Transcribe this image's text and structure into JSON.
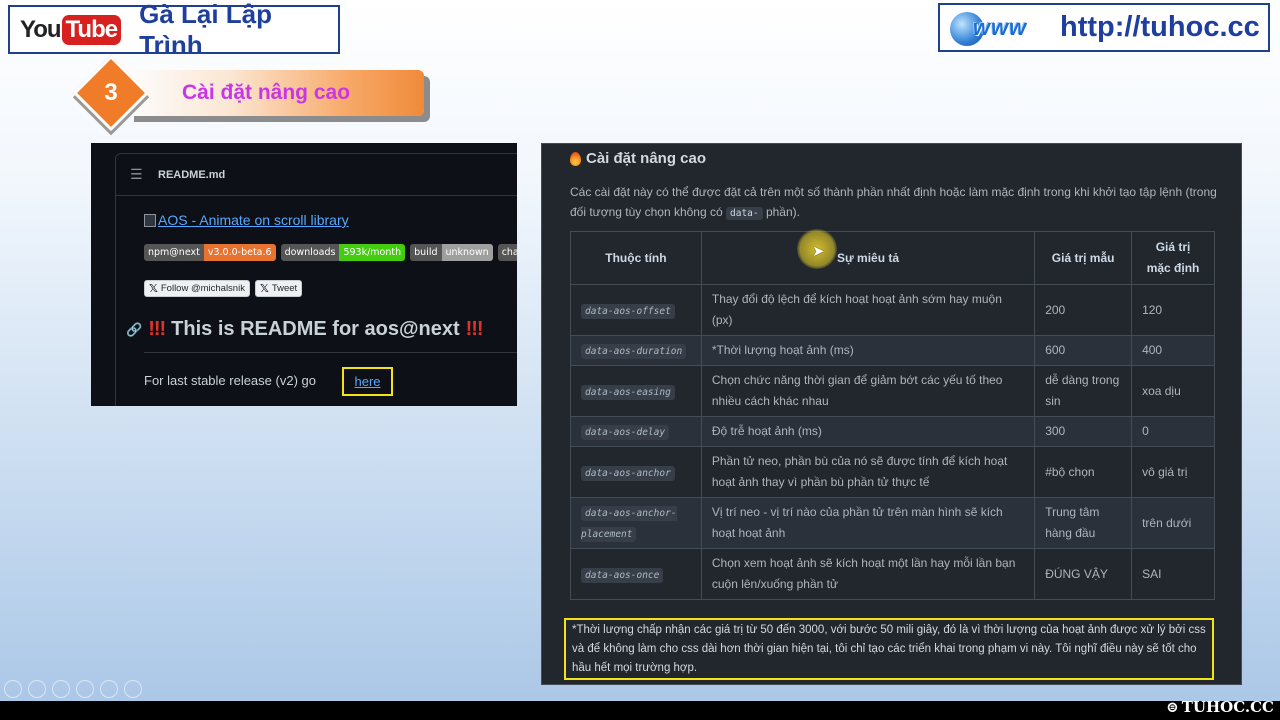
{
  "header": {
    "yt_you": "You",
    "yt_tube": "Tube",
    "channel_name": "Gà Lại Lập Trình",
    "www_text": "www",
    "site_url": "http://tuhoc.cc"
  },
  "step": {
    "number": "3",
    "title": "Cài đặt nâng cao"
  },
  "readme": {
    "file_name": "README.md",
    "aos_link": "AOS - Animate on scroll library",
    "badges": [
      {
        "key": "npm@next",
        "value": "v3.0.0-beta.6",
        "color": "#e8722f"
      },
      {
        "key": "downloads",
        "value": "593k/month",
        "color": "#44cc11"
      },
      {
        "key": "build",
        "value": "unknown",
        "color": "#9f9f9f"
      },
      {
        "key": "cha",
        "value": "",
        "color": "#555555"
      }
    ],
    "follow_button": "Follow @michalsnik",
    "tweet_button": "Tweet",
    "heading_bang": "!!!",
    "heading_text": "This is README for aos@next",
    "paragraph": "For last stable release (v2) go",
    "here_link": "here"
  },
  "settings": {
    "heading": "Cài đặt nâng cao",
    "desc_before": "Các cài đặt này có thể được đặt cả trên một số thành phần nhất định hoặc làm mặc định trong khi khởi tạo tập lệnh (trong đối tượng tùy chọn không có ",
    "desc_code": "data-",
    "desc_after": " phần).",
    "columns": [
      "Thuộc tính",
      "Sự miêu tả",
      "Giá trị mẫu",
      "Giá trị mặc định"
    ],
    "rows": [
      {
        "attr": "data-aos-offset",
        "desc": "Thay đổi độ lệch để kích hoạt hoạt ảnh sớm hay muộn (px)",
        "example": "200",
        "default": "120"
      },
      {
        "attr": "data-aos-duration",
        "desc": "*Thời lượng hoạt ảnh (ms)",
        "example": "600",
        "default": "400"
      },
      {
        "attr": "data-aos-easing",
        "desc": "Chọn chức năng thời gian để giảm bớt các yếu tố theo nhiều cách khác nhau",
        "example": "dễ dàng trong sin",
        "default": "xoa dịu"
      },
      {
        "attr": "data-aos-delay",
        "desc": "Độ trễ hoạt ảnh (ms)",
        "example": "300",
        "default": "0"
      },
      {
        "attr": "data-aos-anchor",
        "desc": "Phần tử neo, phần bù của nó sẽ được tính để kích hoạt hoạt ảnh thay vì phần bù phần tử thực tế",
        "example": "#bộ chọn",
        "default": "vô giá trị"
      },
      {
        "attr": "data-aos-anchor-placement",
        "desc": "Vị trí neo - vị trí nào của phần tử trên màn hình sẽ kích hoạt hoạt ảnh",
        "example": "Trung tâm hàng đầu",
        "default": "trên dưới"
      },
      {
        "attr": "data-aos-once",
        "desc": "Chọn xem hoạt ảnh sẽ kích hoạt một lần hay mỗi lần bạn cuộn lên/xuống phần tử",
        "example": "ĐÚNG VẬY",
        "default": "SAI"
      }
    ],
    "note": "*Thời lượng chấp nhận các giá trị từ 50 đến 3000, với bước 50 mili giây, đó là vì thời lượng của hoạt ảnh được xử lý bởi css và để không làm cho css dài hơn thời gian hiện tại, tôi chỉ tạo các triển khai trong phạm vi này. Tôi nghĩ điều này sẽ tốt cho hầu hết mọi trường hợp."
  },
  "watermark": "TUHOC.CC",
  "colors": {
    "channel_blue": "#1f3f9f",
    "step_orange": "#f07c2a",
    "step_title": "#c936e8",
    "highlight_yellow": "#f3e218"
  }
}
